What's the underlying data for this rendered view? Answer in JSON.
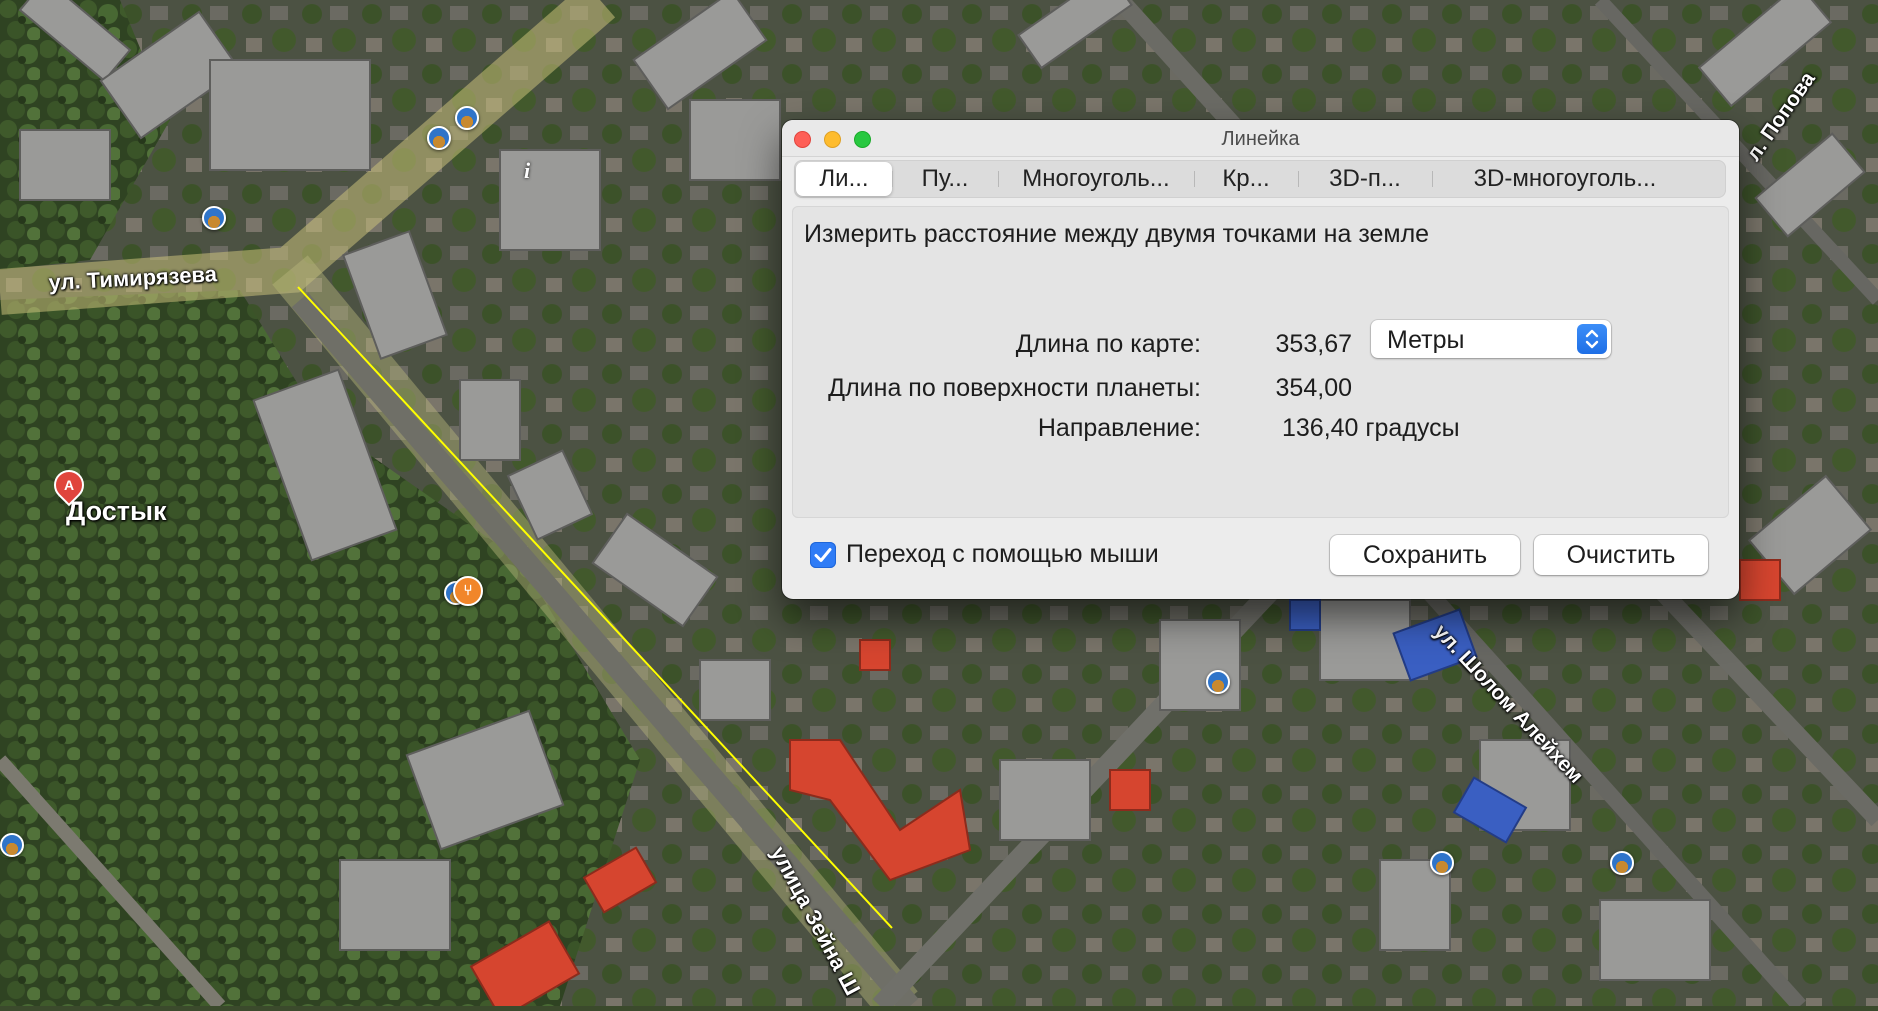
{
  "window": {
    "title": "Линейка"
  },
  "tabs": [
    {
      "label": "Ли...",
      "active": true
    },
    {
      "label": "Пу...",
      "active": false
    },
    {
      "label": "Многоуголь...",
      "active": false
    },
    {
      "label": "Кр...",
      "active": false
    },
    {
      "label": "3D-п...",
      "active": false
    },
    {
      "label": "3D-многоуголь...",
      "active": false
    }
  ],
  "panel": {
    "description": "Измерить расстояние между двумя точками на земле",
    "map_length_label": "Длина по карте:",
    "map_length_value": "353,67",
    "unit_selected": "Метры",
    "surface_length_label": "Длина по поверхности планеты:",
    "surface_length_value": "354,00",
    "heading_label": "Направление:",
    "heading_value": "136,40 градусы"
  },
  "footer": {
    "mouse_navigation_label": "Переход с помощью мыши",
    "mouse_navigation_checked": true,
    "save_label": "Сохранить",
    "clear_label": "Очистить"
  },
  "map": {
    "labels": {
      "timiryazeva": "ул. Тимирязева",
      "dostyk": "Достык",
      "zeyna": "улица Зейна Ш",
      "sholom": "ул. Шолом Алейхем",
      "popova": "л. Попова"
    },
    "marker_a": "A"
  },
  "colors": {
    "accent": "#2f7cf6",
    "ruler_line": "#ffff00",
    "close": "#fe5f57",
    "minimize": "#febc2e",
    "zoom": "#28c840"
  }
}
